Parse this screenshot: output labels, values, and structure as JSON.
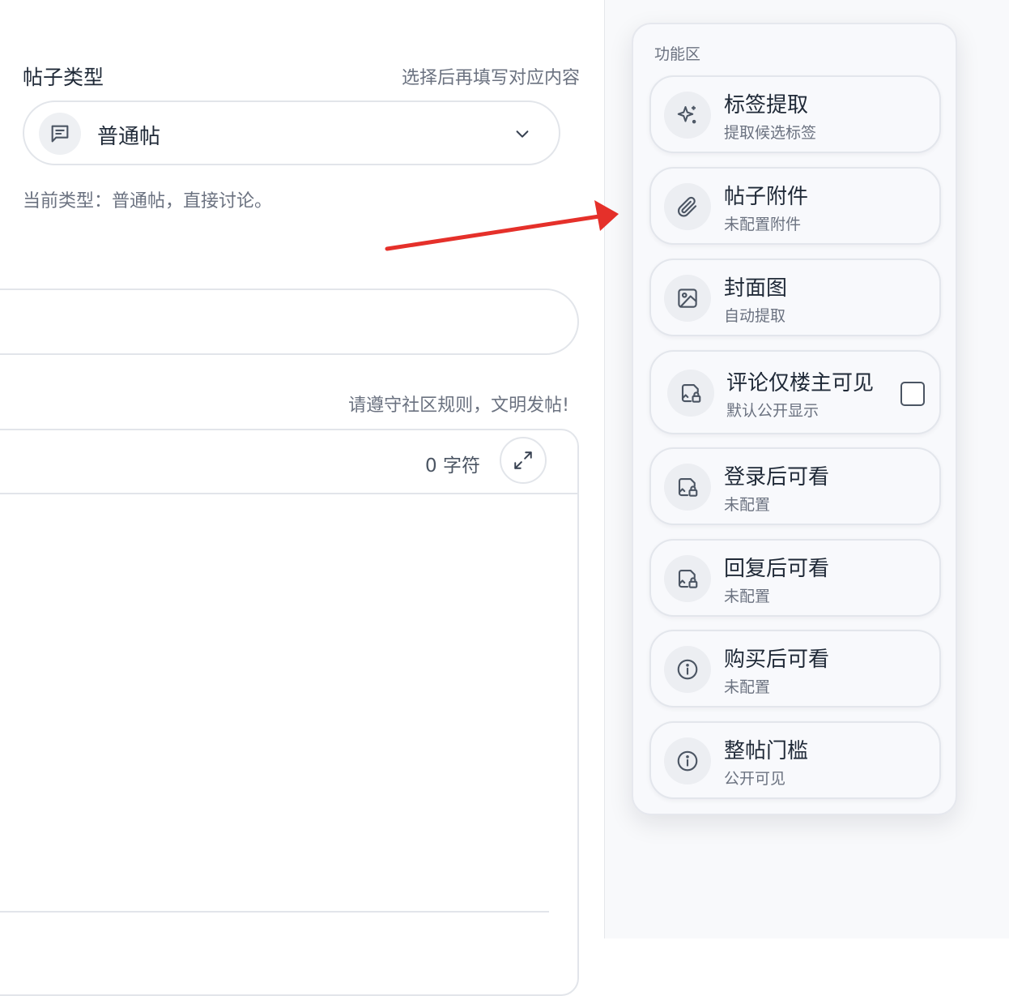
{
  "post_type": {
    "label": "帖子类型",
    "hint": "选择后再填写对应内容",
    "selected": "普通帖",
    "description": "当前类型：普通帖，直接讨论。"
  },
  "editor": {
    "rules_hint": "请遵守社区规则，文明发帖!",
    "char_count": "0 字符"
  },
  "panel": {
    "title": "功能区",
    "cards": [
      {
        "title": "标签提取",
        "subtitle": "提取候选标签",
        "icon": "sparkle-icon"
      },
      {
        "title": "帖子附件",
        "subtitle": "未配置附件",
        "icon": "paperclip-icon"
      },
      {
        "title": "封面图",
        "subtitle": "自动提取",
        "icon": "image-icon"
      },
      {
        "title": "评论仅楼主可见",
        "subtitle": "默认公开显示",
        "icon": "file-lock-icon",
        "checkbox": false
      },
      {
        "title": "登录后可看",
        "subtitle": "未配置",
        "icon": "file-lock-icon"
      },
      {
        "title": "回复后可看",
        "subtitle": "未配置",
        "icon": "file-lock-icon"
      },
      {
        "title": "购买后可看",
        "subtitle": "未配置",
        "icon": "info-icon"
      },
      {
        "title": "整帖门槛",
        "subtitle": "公开可见",
        "icon": "info-icon"
      }
    ]
  },
  "colors": {
    "annotation_arrow": "#e5302a",
    "border": "#e2e5ea",
    "muted_text": "#6b7280"
  }
}
